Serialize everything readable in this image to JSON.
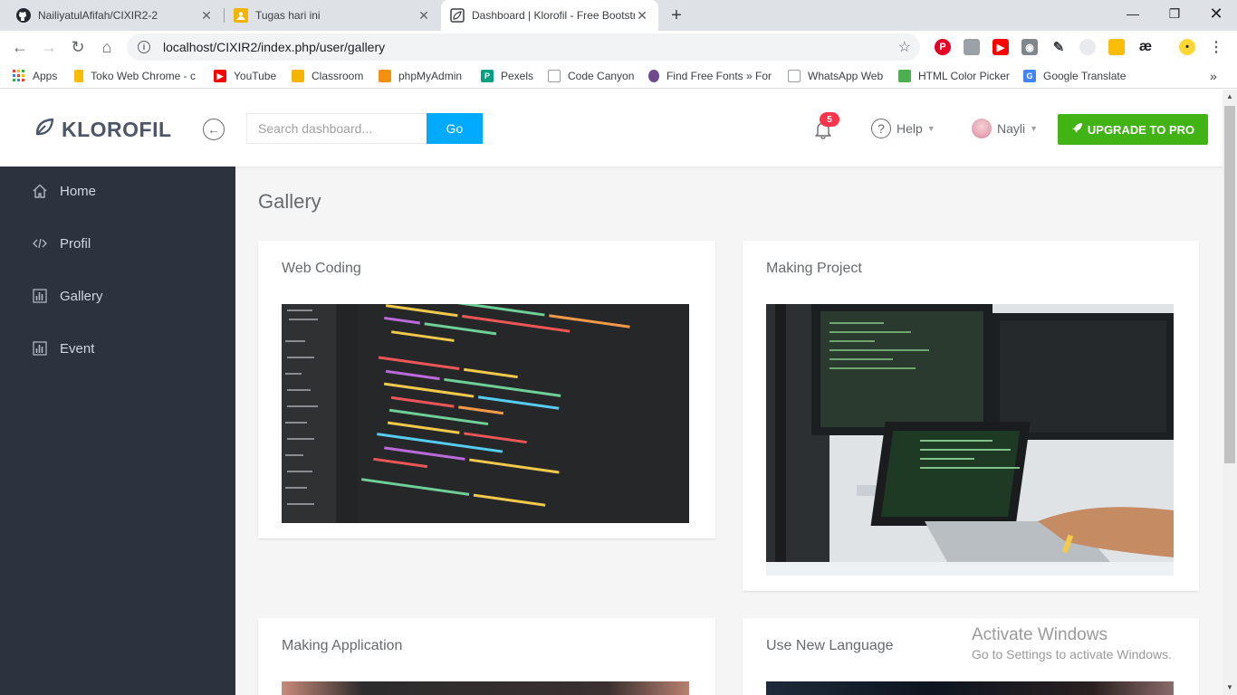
{
  "browser": {
    "tabs": [
      {
        "title": "NailiyatulAfifah/CIXIR2-2",
        "icon": "github-icon"
      },
      {
        "title": "Tugas hari ini",
        "icon": "classroom-icon"
      },
      {
        "title": "Dashboard | Klorofil - Free Bootstr",
        "icon": "klorofil-icon",
        "active": true
      }
    ],
    "url": "localhost/CIXIR2/index.php/user/gallery",
    "bookmarks": [
      {
        "label": "Apps",
        "color": "#ea4335"
      },
      {
        "label": "Toko Web Chrome - c",
        "color": "#fbbc05"
      },
      {
        "label": "YouTube",
        "color": "#ff0000"
      },
      {
        "label": "Classroom",
        "color": "#f4b400"
      },
      {
        "label": "phpMyAdmin",
        "color": "#f29111"
      },
      {
        "label": "Pexels",
        "color": "#05a081"
      },
      {
        "label": "Code Canyon",
        "color": "#9aa0a6"
      },
      {
        "label": "Find Free Fonts » For",
        "color": "#6f4a8e"
      },
      {
        "label": "WhatsApp Web",
        "color": "#9aa0a6"
      },
      {
        "label": "HTML Color Picker",
        "color": "#4caf50"
      },
      {
        "label": "Google Translate",
        "color": "#4285f4"
      }
    ]
  },
  "header": {
    "brand": "KLOROFIL",
    "search_placeholder": "Search dashboard...",
    "search_button": "Go",
    "notification_count": "5",
    "help_label": "Help",
    "user_name": "Nayli",
    "upgrade_label": "UPGRADE TO PRO"
  },
  "sidebar": {
    "items": [
      {
        "label": "Home",
        "icon": "home-icon"
      },
      {
        "label": "Profil",
        "icon": "code-icon"
      },
      {
        "label": "Gallery",
        "icon": "bar-chart-icon"
      },
      {
        "label": "Event",
        "icon": "bar-chart-icon"
      }
    ]
  },
  "main": {
    "title": "Gallery",
    "cards": [
      {
        "title": "Web Coding"
      },
      {
        "title": "Making Project"
      },
      {
        "title": "Making Application"
      },
      {
        "title": "Use New Language"
      }
    ]
  },
  "watermark": {
    "line1": "Activate Windows",
    "line2": "Go to Settings to activate Windows."
  },
  "colors": {
    "sidebar_bg": "#2b333e",
    "accent_blue": "#00aaff",
    "upgrade_green": "#41b314",
    "badge_red": "#f9354c"
  }
}
